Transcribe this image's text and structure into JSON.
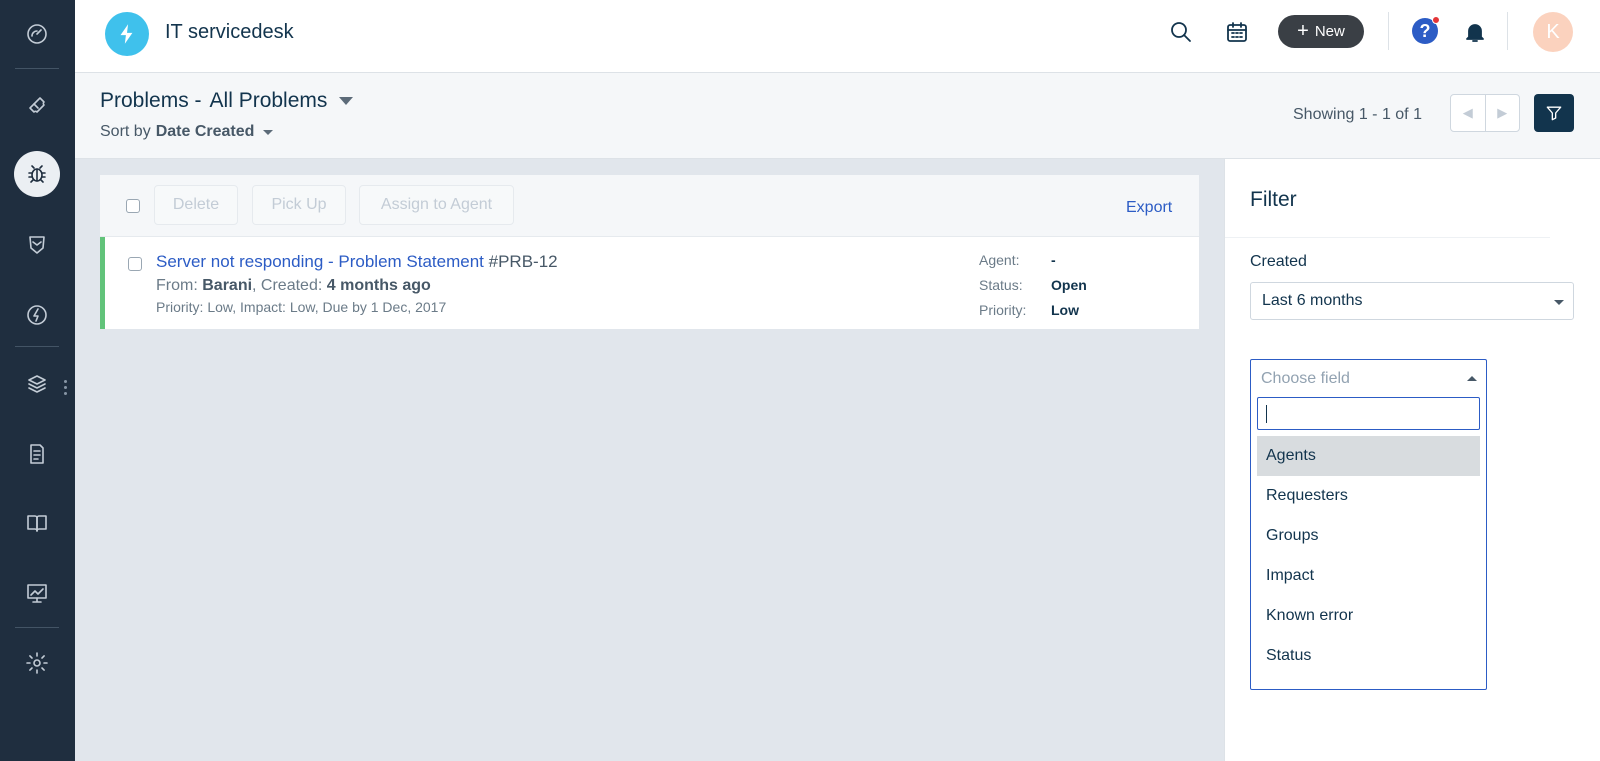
{
  "app": {
    "title": "IT servicedesk",
    "new_label": "New",
    "help_glyph": "?",
    "avatar_initial": "K"
  },
  "sidebar": {
    "items": [
      {
        "icon": "dashboard-icon"
      },
      {
        "icon": "ticket-icon"
      },
      {
        "icon": "bug-icon",
        "active": true
      },
      {
        "icon": "shield-icon"
      },
      {
        "icon": "lightning-icon"
      },
      {
        "icon": "layers-icon"
      },
      {
        "icon": "document-icon"
      },
      {
        "icon": "book-icon"
      },
      {
        "icon": "chart-icon"
      },
      {
        "icon": "gear-icon"
      }
    ]
  },
  "header": {
    "module": "Problems -",
    "view": "All Problems",
    "sort_prefix": "Sort by",
    "sort_value": "Date Created",
    "showing": "Showing 1 - 1 of 1"
  },
  "toolbar": {
    "delete_label": "Delete",
    "pickup_label": "Pick Up",
    "assign_label": "Assign to Agent",
    "export_label": "Export"
  },
  "tickets": [
    {
      "subject": "Server not responding - Problem Statement",
      "id": "#PRB-12",
      "from_label": "From:",
      "from": "Barani",
      "created_label": ", Created:",
      "created": "4 months ago",
      "meta": "Priority: Low,  Impact: Low,  Due by 1 Dec, 2017",
      "agent_label": "Agent:",
      "agent": "-",
      "status_label": "Status:",
      "status": "Open",
      "priority_label": "Priority:",
      "priority": "Low"
    }
  ],
  "filter": {
    "title": "Filter",
    "created_label": "Created",
    "created_value": "Last 6 months",
    "chooser_placeholder": "Choose field",
    "options": [
      "Agents",
      "Requesters",
      "Groups",
      "Impact",
      "Known error",
      "Status"
    ],
    "highlighted": "Agents"
  },
  "colors": {
    "sidebar": "#1f2e3f",
    "accent": "#2c5cc5",
    "status_bar": "#62c37a",
    "brand": "#3fc1ec"
  }
}
